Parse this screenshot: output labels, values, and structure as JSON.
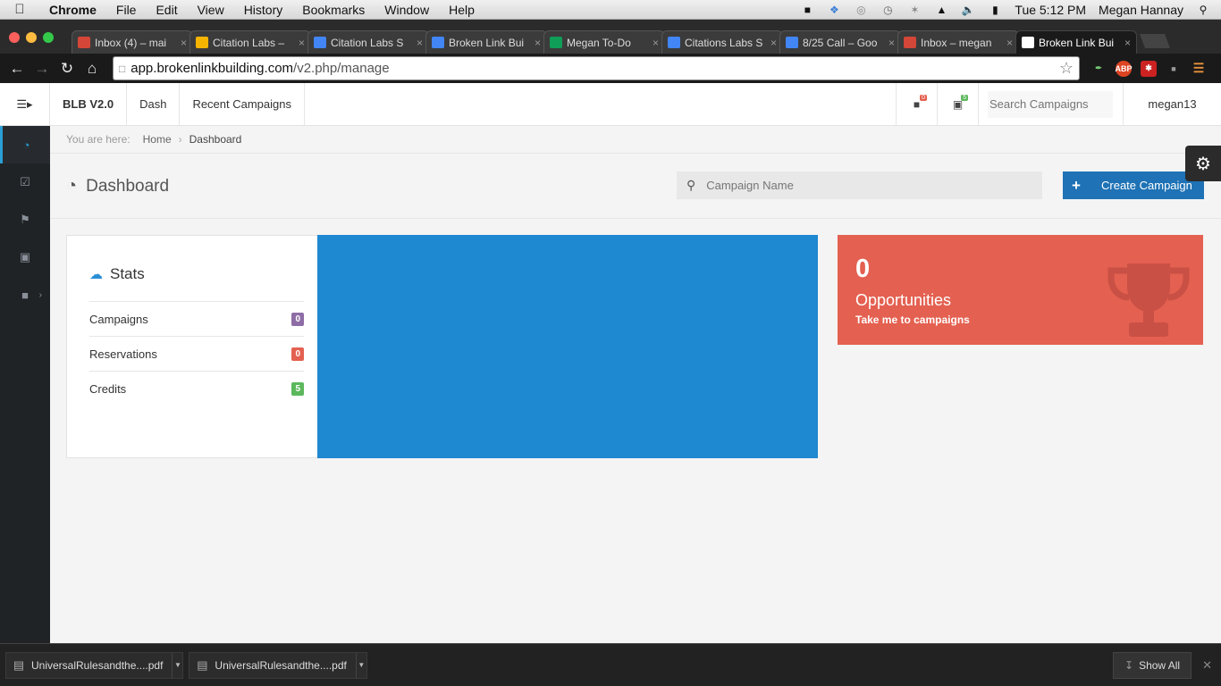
{
  "macbar": {
    "app": "Chrome",
    "menus": [
      "File",
      "Edit",
      "View",
      "History",
      "Bookmarks",
      "Window",
      "Help"
    ],
    "clock": "Tue 5:12 PM",
    "user": "Megan Hannay"
  },
  "tabs": [
    {
      "title": "Inbox (4) – mai",
      "fav": "gmail",
      "color": "#d44638"
    },
    {
      "title": "Citation Labs –",
      "fav": "drive",
      "color": "#f4b400"
    },
    {
      "title": "Citation Labs S",
      "fav": "docs",
      "color": "#4285f4"
    },
    {
      "title": "Broken Link Bui",
      "fav": "docs",
      "color": "#4285f4"
    },
    {
      "title": "Megan To-Do",
      "fav": "sheets",
      "color": "#0f9d58"
    },
    {
      "title": "Citations Labs S",
      "fav": "docs",
      "color": "#4285f4"
    },
    {
      "title": "8/25 Call – Goo",
      "fav": "docs",
      "color": "#4285f4"
    },
    {
      "title": "Inbox – megan",
      "fav": "gmail",
      "color": "#d44638"
    },
    {
      "title": "Broken Link Bui",
      "fav": "page",
      "color": "#ffffff"
    }
  ],
  "omnibox": {
    "domain": "app.brokenlinkbuilding.com",
    "path": "/v2.php/manage"
  },
  "topnav": {
    "brand": "BLB V2.0",
    "dash": "Dash",
    "recent": "Recent Campaigns",
    "reservations_badge": "0",
    "credits_badge": "5",
    "search_placeholder": "Search Campaigns",
    "username": "megan13"
  },
  "breadcrumb": {
    "prefix": "You are here:",
    "home": "Home",
    "current": "Dashboard"
  },
  "page": {
    "title": "Dashboard",
    "campaign_placeholder": "Campaign Name",
    "create_label": "Create Campaign"
  },
  "stats": {
    "title": "Stats",
    "rows": [
      {
        "label": "Campaigns",
        "value": "0",
        "color": "#8e6da7"
      },
      {
        "label": "Reservations",
        "value": "0",
        "color": "#e46050"
      },
      {
        "label": "Credits",
        "value": "5",
        "color": "#5cb85c"
      }
    ]
  },
  "opportunities": {
    "count": "0",
    "title": "Opportunities",
    "link": "Take me to campaigns"
  },
  "downloads": {
    "items": [
      "UniversalRulesandthe....pdf",
      "UniversalRulesandthe....pdf"
    ],
    "show_all": "Show All"
  },
  "colors": {
    "accent": "#1e72b5",
    "panel_blue": "#1e88d0",
    "opp_red": "#e46050",
    "sidebar": "#1f2326"
  }
}
